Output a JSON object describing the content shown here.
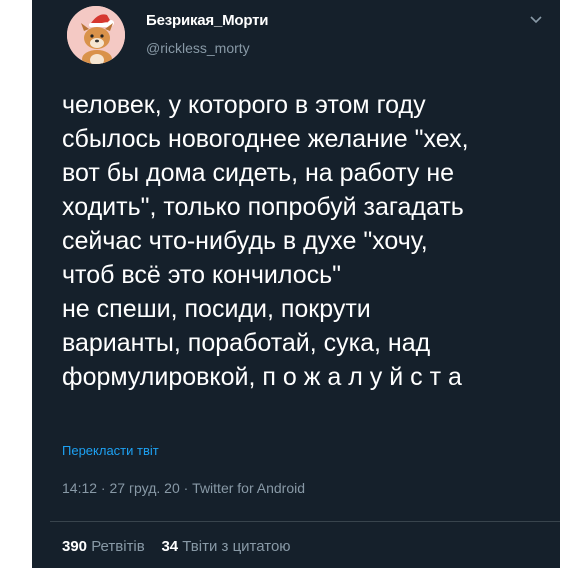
{
  "author": {
    "display_name": "Безрикая_Морти",
    "handle": "@rickless_morty",
    "avatar_icon": "dog-with-santa-hat-icon"
  },
  "tweet": {
    "lines": [
      "человек, у которого в этом году",
      "сбылось новогоднее желание \"хех,",
      "вот бы дома сидеть, на работу не",
      "ходить\", только попробуй загадать",
      "сейчас что-нибудь в духе \"хочу,",
      "чтоб всё это кончилось\"",
      "не спеши, посиди, покрути",
      "варианты, поработай, сука, над",
      "формулировкой, п о ж а л у й с т а"
    ],
    "translate_label": "Перекласти твіт",
    "meta": "14:12 · 27 груд. 20 · Twitter for Android"
  },
  "stats": {
    "retweets_count": "390",
    "retweets_label": "Ретвітів",
    "quotes_count": "34",
    "quotes_label": "Твіти з цитатою"
  },
  "colors": {
    "background": "#15202b",
    "secondary_text": "#8899a6",
    "link": "#1da1f2",
    "divider": "#38444d"
  }
}
